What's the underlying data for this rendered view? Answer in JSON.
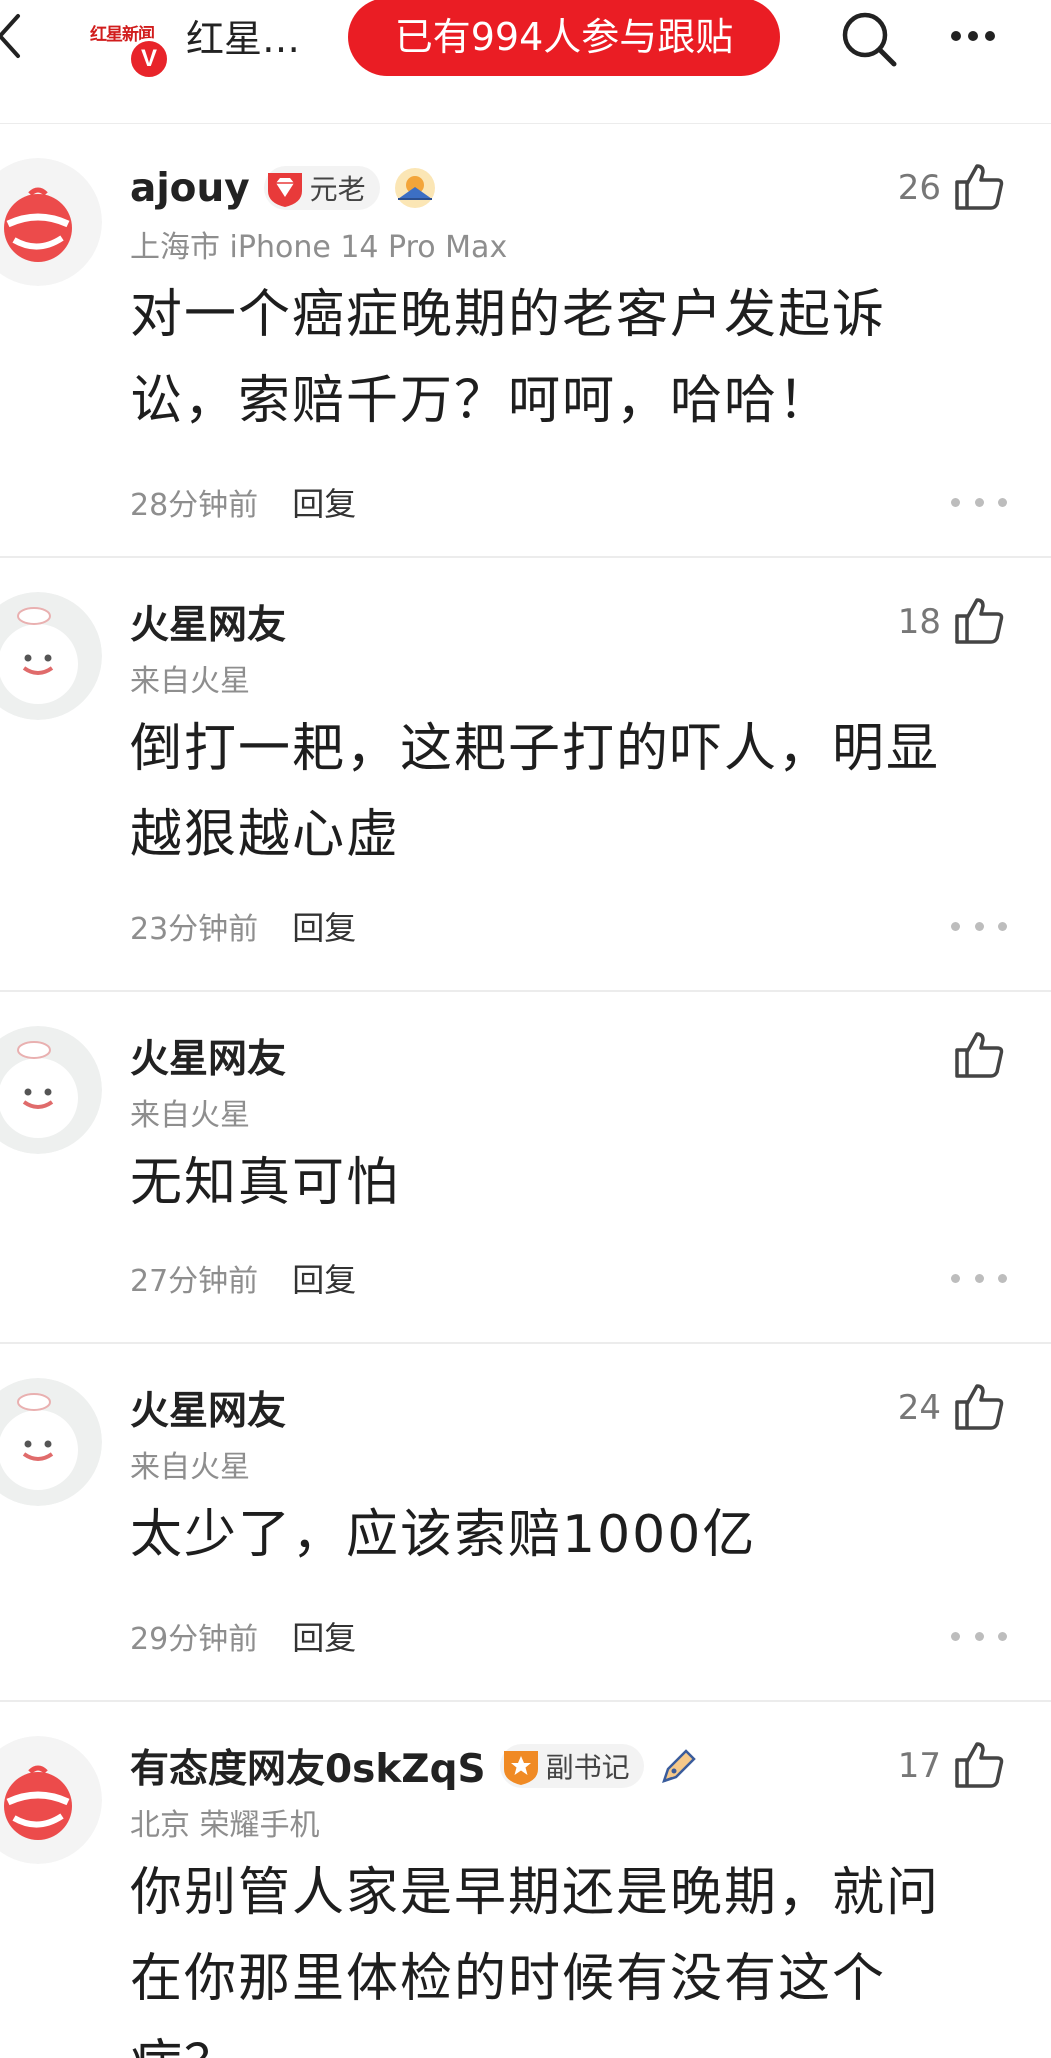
{
  "header": {
    "brand_logo_text": "红星新闻",
    "brand_v": "V",
    "channel_name": "红星…",
    "follow_label": "已有994人参与跟贴"
  },
  "comments": [
    {
      "user": "ajouy",
      "badge": "元老",
      "meta": "上海市  iPhone 14 Pro Max",
      "likes": "26",
      "text": "对一个癌症晚期的老客户发起诉讼，索赔千万？呵呵，哈哈！",
      "time": "28分钟前",
      "reply": "回复"
    },
    {
      "user": "火星网友",
      "meta": "来自火星",
      "likes": "18",
      "text": "倒打一耙，这耙子打的吓人，明显越狠越心虚",
      "time": "23分钟前",
      "reply": "回复"
    },
    {
      "user": "火星网友",
      "meta": "来自火星",
      "likes": "",
      "text": "无知真可怕",
      "time": "27分钟前",
      "reply": "回复"
    },
    {
      "user": "火星网友",
      "meta": "来自火星",
      "likes": "24",
      "text": "太少了，应该索赔1000亿",
      "time": "29分钟前",
      "reply": "回复"
    },
    {
      "user": "有态度网友0skZqS",
      "badge": "副书记",
      "meta": "北京   荣耀手机",
      "likes": "17",
      "text": "你别管人家是早期还是晚期，就问在你那里体检的时候有没有这个病？",
      "time": "",
      "reply": ""
    }
  ],
  "colors": {
    "accent_red": "#ea1d24",
    "muted_text": "#8e8e8e",
    "divider": "#ececec"
  },
  "icons": [
    "back-arrow-icon",
    "search-icon",
    "more-horizontal-icon",
    "thumbs-up-icon",
    "diamond-badge-icon",
    "sunrise-badge-icon",
    "star-badge-icon",
    "pen-badge-icon",
    "avatar-red-icon",
    "avatar-white-icon"
  ]
}
